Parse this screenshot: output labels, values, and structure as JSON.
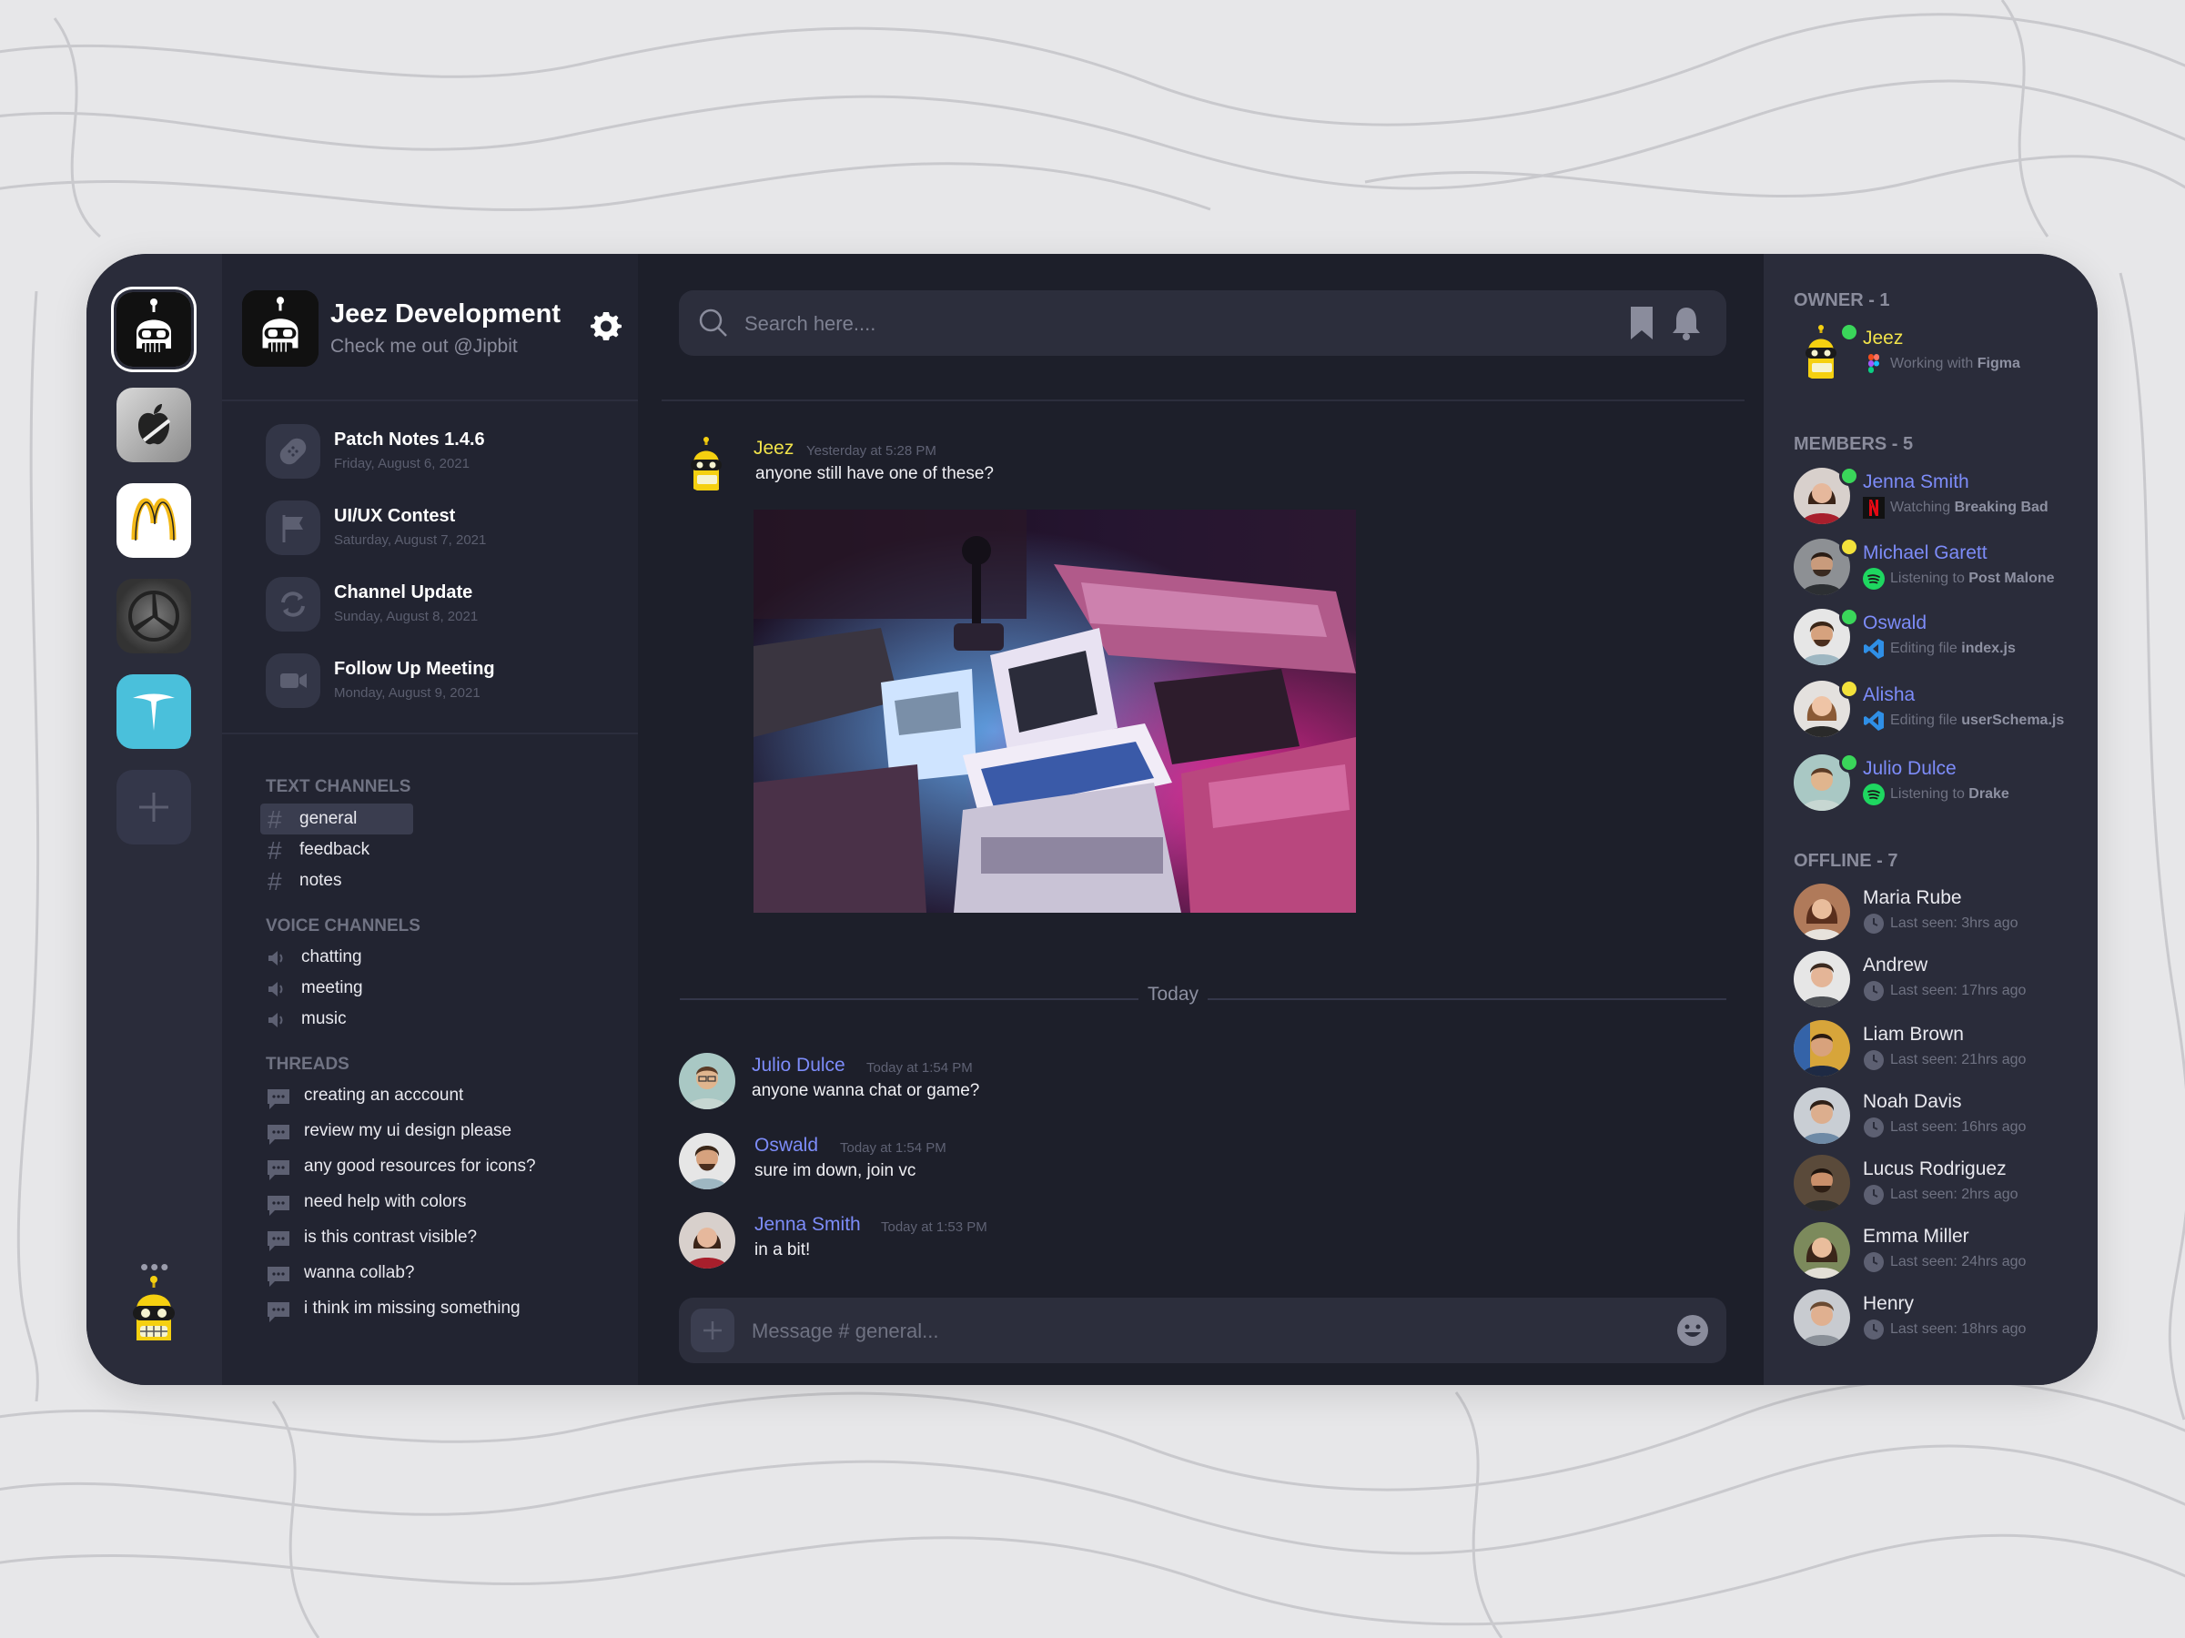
{
  "colors": {
    "accent": "#7d8cf9",
    "owner": "#f0e24a",
    "online": "#3ad65a",
    "idle": "#f3e23b",
    "background": "#1d1f2a"
  },
  "rail": {
    "servers": [
      {
        "name": "jeez-server",
        "icon": "robot-icon"
      },
      {
        "name": "apple-server",
        "icon": "apple-logo-icon"
      },
      {
        "name": "mcdonalds-server",
        "icon": "mcdonalds-logo-icon"
      },
      {
        "name": "mercedes-server",
        "icon": "mercedes-logo-icon"
      },
      {
        "name": "tesla-server",
        "icon": "tesla-logo-icon"
      }
    ],
    "add_icon": "plus-icon",
    "more": "•••"
  },
  "server": {
    "name": "Jeez Development",
    "subtitle": "Check me out @Jipbit"
  },
  "announcements": [
    {
      "title": "Patch Notes 1.4.6",
      "date": "Friday, August 6, 2021",
      "icon": "patch-icon"
    },
    {
      "title": "UI/UX Contest",
      "date": "Saturday, August 7, 2021",
      "icon": "flag-icon"
    },
    {
      "title": "Channel Update",
      "date": "Sunday, August 8, 2021",
      "icon": "refresh-icon"
    },
    {
      "title": "Follow Up Meeting",
      "date": "Monday, August 9, 2021",
      "icon": "video-icon"
    }
  ],
  "text_channels": {
    "heading": "TEXT CHANNELS",
    "items": [
      "general",
      "feedback",
      "notes"
    ],
    "selected": "general"
  },
  "voice_channels": {
    "heading": "VOICE CHANNELS",
    "items": [
      "chatting",
      "meeting",
      "music"
    ]
  },
  "threads": {
    "heading": "THREADS",
    "items": [
      "creating an acccount",
      "review my ui design please",
      "any good resources for icons?",
      "need help with colors",
      "is this contrast visible?",
      "wanna collab?",
      "i think im missing something"
    ]
  },
  "search": {
    "placeholder": "Search here...."
  },
  "messages_before": [
    {
      "author": "Jeez",
      "time": "Yesterday at 5:28 PM",
      "text": "anyone still have one of these?",
      "has_image": true
    }
  ],
  "divider": "Today",
  "messages": [
    {
      "author": "Julio Dulce",
      "time": "Today at 1:54 PM",
      "text": "anyone wanna chat or game?"
    },
    {
      "author": "Oswald",
      "time": "Today at 1:54 PM",
      "text": "sure im down, join vc"
    },
    {
      "author": "Jenna Smith",
      "time": "Today at 1:53 PM",
      "text": "in a bit!"
    }
  ],
  "composer": {
    "placeholder": "Message # general..."
  },
  "owner": {
    "heading": "OWNER - 1",
    "name": "Jeez",
    "status_prefix": "Working with",
    "status_bold": "Figma",
    "status_icon": "figma-icon"
  },
  "members": {
    "heading": "MEMBERS - 5",
    "items": [
      {
        "name": "Jenna Smith",
        "presence": "online",
        "status_prefix": "Watching",
        "status_bold": "Breaking Bad",
        "status_icon": "netflix-icon"
      },
      {
        "name": "Michael Garett",
        "presence": "idle",
        "status_prefix": "Listening to",
        "status_bold": "Post Malone",
        "status_icon": "spotify-icon"
      },
      {
        "name": "Oswald",
        "presence": "online",
        "status_prefix": "Editing file",
        "status_bold": "index.js",
        "status_icon": "vscode-icon"
      },
      {
        "name": "Alisha",
        "presence": "idle",
        "status_prefix": "Editing file",
        "status_bold": "userSchema.js",
        "status_icon": "vscode-icon"
      },
      {
        "name": "Julio Dulce",
        "presence": "online",
        "status_prefix": "Listening to",
        "status_bold": "Drake",
        "status_icon": "spotify-icon"
      }
    ]
  },
  "offline": {
    "heading": "OFFLINE - 7",
    "items": [
      {
        "name": "Maria Rube",
        "status": "Last seen: 3hrs ago"
      },
      {
        "name": "Andrew",
        "status": "Last seen: 17hrs ago"
      },
      {
        "name": "Liam Brown",
        "status": "Last seen: 21hrs ago"
      },
      {
        "name": "Noah Davis",
        "status": "Last seen: 16hrs ago"
      },
      {
        "name": "Lucus Rodriguez",
        "status": "Last seen: 2hrs ago"
      },
      {
        "name": "Emma Miller",
        "status": "Last seen: 24hrs ago"
      },
      {
        "name": "Henry",
        "status": "Last seen: 18hrs ago"
      }
    ]
  }
}
